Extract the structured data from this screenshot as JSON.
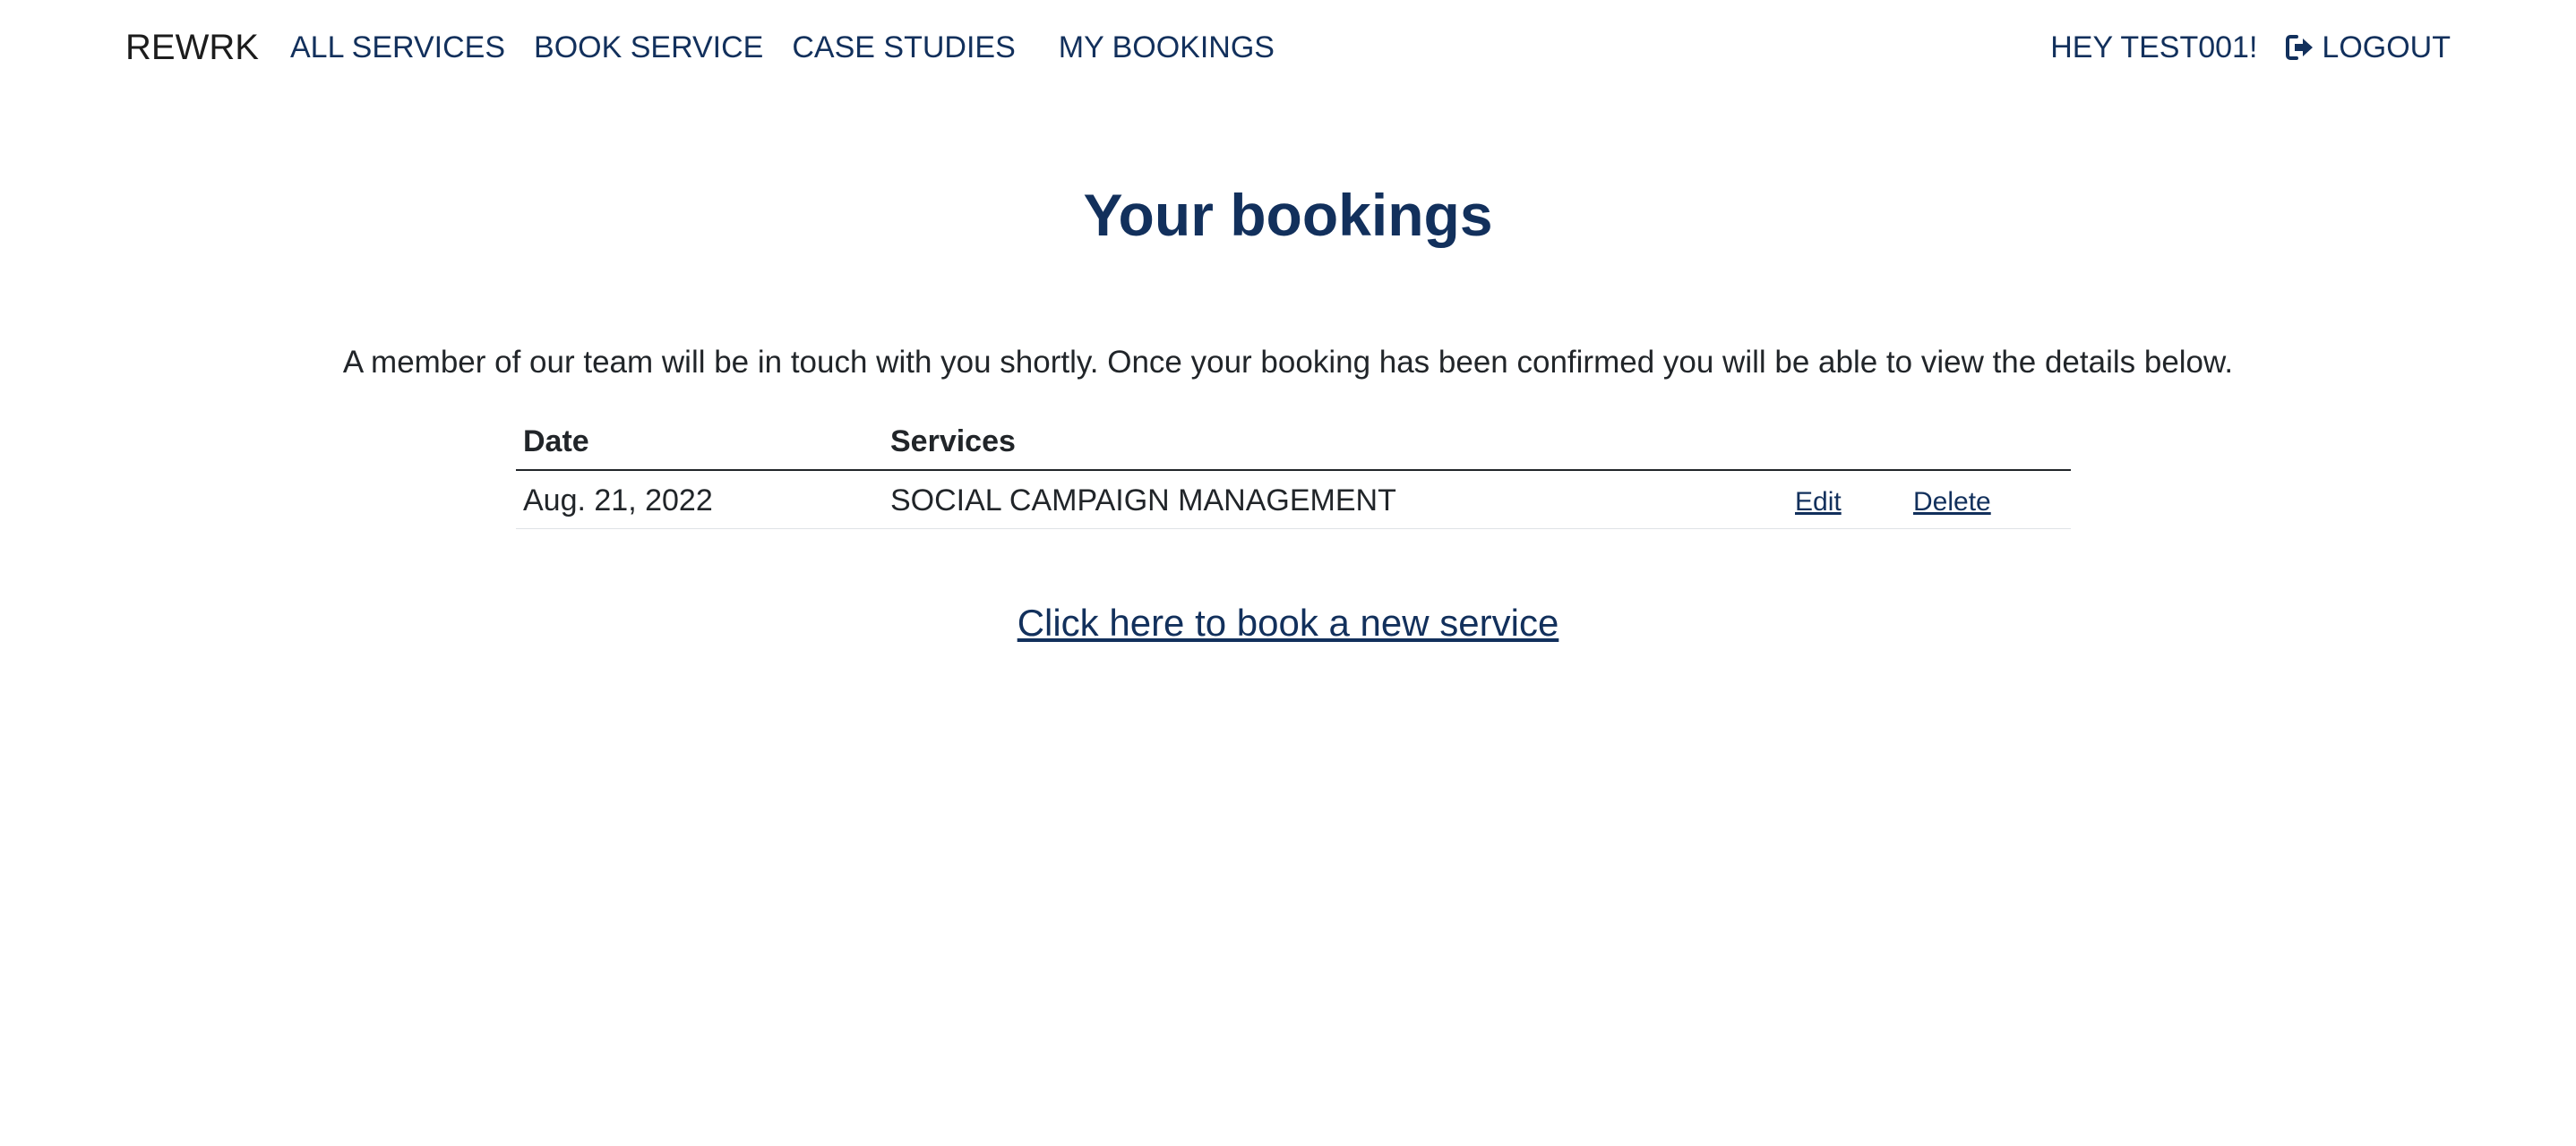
{
  "navbar": {
    "brand": "REWRK",
    "links": [
      "ALL SERVICES",
      "BOOK SERVICE",
      "CASE STUDIES",
      "MY BOOKINGS"
    ],
    "greeting": "HEY TEST001!",
    "logout_label": "LOGOUT",
    "logout_icon": "sign-out-icon"
  },
  "main": {
    "title": "Your bookings",
    "intro": "A member of our team will be in touch with you shortly. Once your booking has been confirmed you will be able to view the details below.",
    "table": {
      "headers": [
        "Date",
        "Services"
      ],
      "rows": [
        {
          "date": "Aug. 21, 2022",
          "service": "SOCIAL CAMPAIGN MANAGEMENT",
          "edit": "Edit",
          "delete": "Delete"
        }
      ]
    },
    "book_new_link": "Click here to book a new service"
  },
  "colors": {
    "accent": "#12305c",
    "text": "#212529",
    "background": "#ffffff"
  }
}
